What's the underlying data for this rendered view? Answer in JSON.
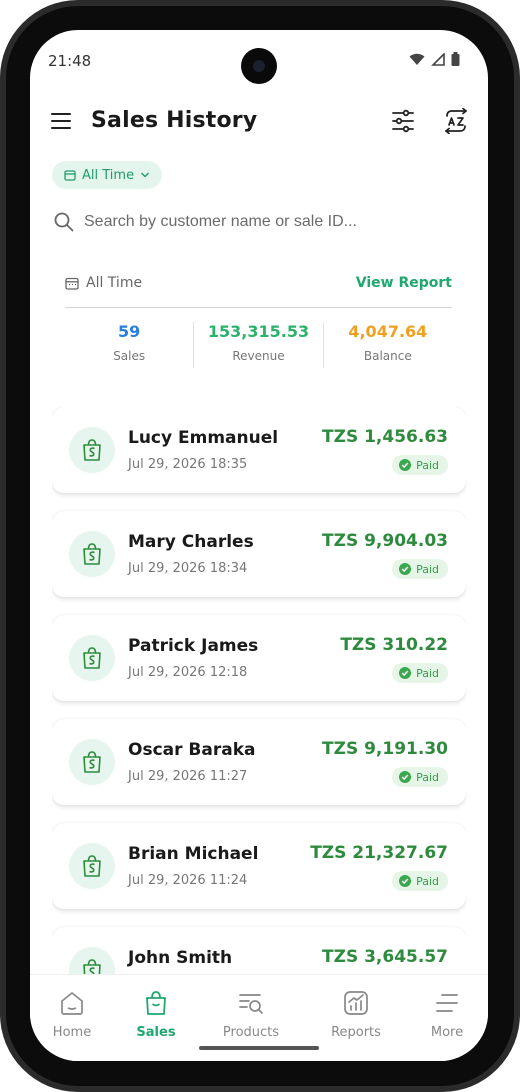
{
  "status_bar": {
    "time": "21:48"
  },
  "header": {
    "title": "Sales History"
  },
  "filter_chip": {
    "label": "All Time"
  },
  "search": {
    "placeholder": "Search by customer name or sale ID..."
  },
  "summary": {
    "period_label": "All Time",
    "view_report_label": "View Report",
    "stats": [
      {
        "value": "59",
        "label": "Sales",
        "color": "#2a7ee0"
      },
      {
        "value": "153,315.53",
        "label": "Revenue",
        "color": "#2cb36b"
      },
      {
        "value": "4,047.64",
        "label": "Balance",
        "color": "#f0a020"
      }
    ]
  },
  "sales": [
    {
      "customer": "Lucy Emmanuel",
      "date": "Jul 29, 2026 18:35",
      "amount": "TZS 1,456.63",
      "status": "Paid"
    },
    {
      "customer": "Mary Charles",
      "date": "Jul 29, 2026 18:34",
      "amount": "TZS 9,904.03",
      "status": "Paid"
    },
    {
      "customer": "Patrick James",
      "date": "Jul 29, 2026 12:18",
      "amount": "TZS 310.22",
      "status": "Paid"
    },
    {
      "customer": "Oscar Baraka",
      "date": "Jul 29, 2026 11:27",
      "amount": "TZS 9,191.30",
      "status": "Paid"
    },
    {
      "customer": "Brian Michael",
      "date": "Jul 29, 2026 11:24",
      "amount": "TZS 21,327.67",
      "status": "Paid"
    },
    {
      "customer": "John Smith",
      "date": "",
      "amount": "TZS 3,645.57",
      "status": ""
    }
  ],
  "bottom_nav": {
    "items": [
      {
        "label": "Home",
        "icon": "home-icon"
      },
      {
        "label": "Sales",
        "icon": "shopping-bag-icon",
        "active": true
      },
      {
        "label": "Products",
        "icon": "product-search-icon"
      },
      {
        "label": "Reports",
        "icon": "reports-chart-icon"
      },
      {
        "label": "More",
        "icon": "more-menu-icon"
      }
    ]
  },
  "colors": {
    "accent": "#1fa870",
    "amount_green": "#2e8b3e",
    "badge_bg": "#e5f6e8"
  }
}
